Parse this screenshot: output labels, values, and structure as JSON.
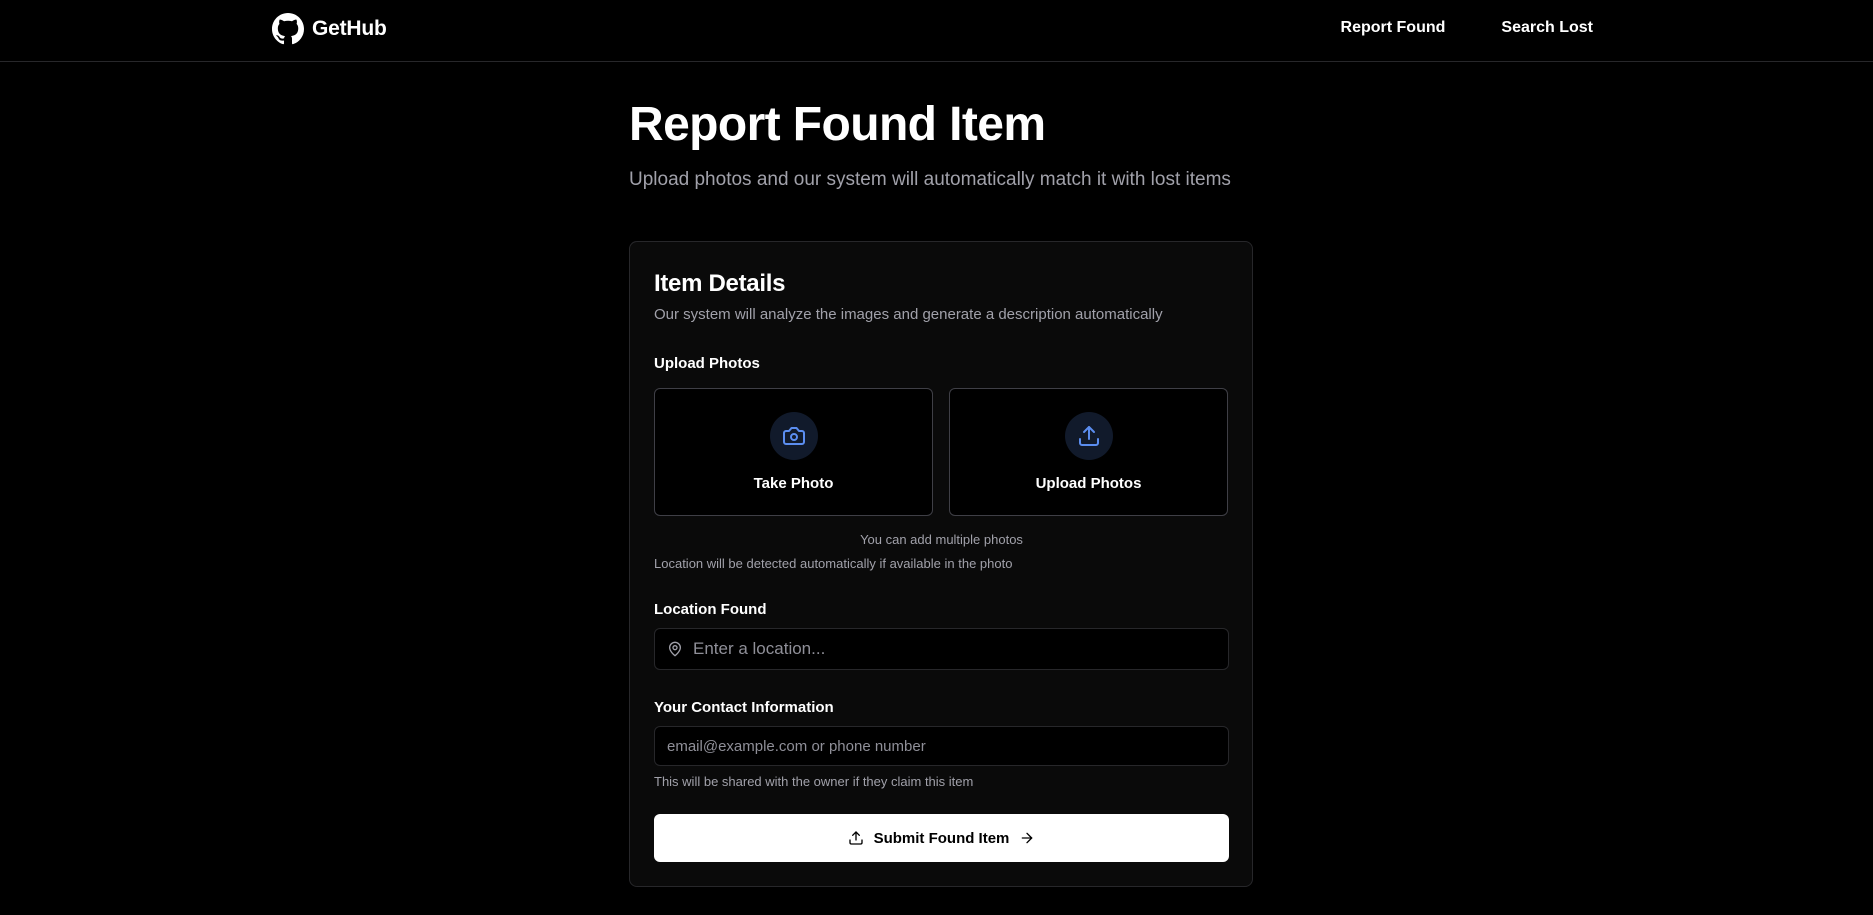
{
  "nav": {
    "brand": "GetHub",
    "links": [
      "Report Found",
      "Search Lost"
    ]
  },
  "page": {
    "title": "Report Found Item",
    "subtitle": "Upload photos and our system will automatically match it with lost items"
  },
  "card": {
    "title": "Item Details",
    "description": "Our system will analyze the images and generate a description automatically",
    "upload": {
      "label": "Upload Photos",
      "take_photo": "Take Photo",
      "upload_photos": "Upload Photos",
      "multiple_hint": "You can add multiple photos",
      "location_hint": "Location will be detected automatically if available in the photo"
    },
    "location": {
      "label": "Location Found",
      "placeholder": "Enter a location...",
      "value": ""
    },
    "contact": {
      "label": "Your Contact Information",
      "placeholder": "email@example.com or phone number",
      "value": "",
      "note": "This will be shared with the owner if they claim this item"
    },
    "submit_label": "Submit Found Item"
  },
  "icons": {
    "brand": "github-octocat-icon",
    "camera": "camera-icon",
    "upload": "upload-icon",
    "location": "map-pin-icon",
    "submit_left": "upload-icon",
    "submit_right": "arrow-right-icon"
  },
  "colors": {
    "background": "#000000",
    "card": "#0a0a0a",
    "border": "#27272a",
    "muted_text": "#a1a1aa",
    "accent_icon": "#5b8def",
    "icon_circle": "#111a2b",
    "button_bg": "#ffffff"
  }
}
